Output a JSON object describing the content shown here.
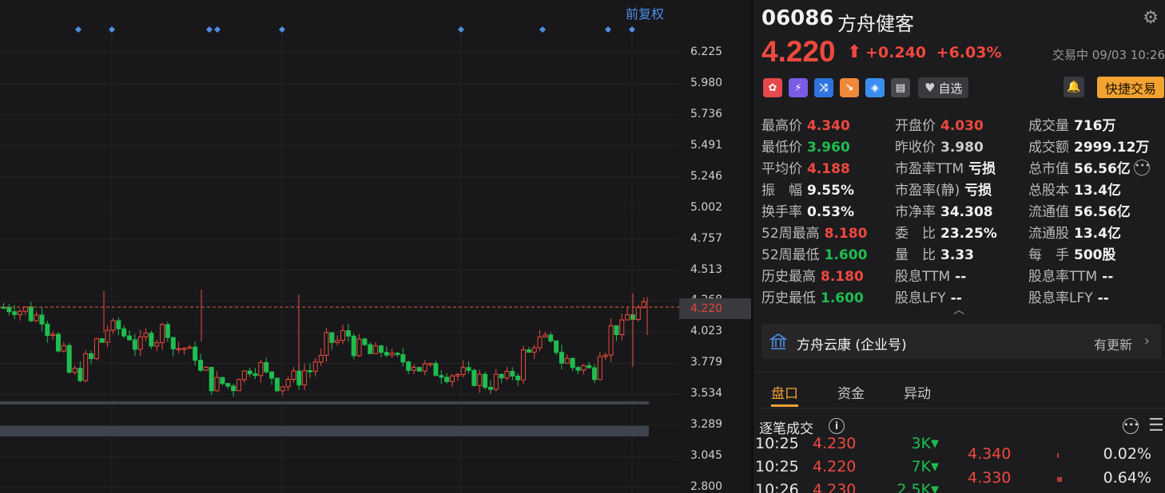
{
  "chart": {
    "adjust_label": "前复权",
    "y_ticks": [
      "6.225",
      "5.980",
      "5.736",
      "5.491",
      "5.246",
      "5.002",
      "4.757",
      "4.513",
      "4.268",
      "4.023",
      "3.779",
      "3.534",
      "3.289",
      "3.045",
      "2.800"
    ],
    "y_min": 2.8,
    "y_max": 6.225,
    "current_price_label": "4.220",
    "current_price": 4.22,
    "event_marker_x": [
      98,
      140,
      262,
      272,
      353,
      577,
      679,
      761,
      791
    ],
    "colors": {
      "up": "#ee4a3e",
      "down": "#1fbd4f",
      "marker": "#4f8fe8"
    }
  },
  "stock": {
    "code": "06086",
    "name": "方舟健客",
    "price": "4.220",
    "change": "+0.240",
    "change_pct": "+6.03%",
    "status": "交易中 09/03 10:26"
  },
  "toolbar": {
    "watch_label": "自选",
    "quick_trade_label": "快捷交易",
    "icons": [
      "hk-market-icon",
      "lightning-icon",
      "shuffle-icon",
      "trend-icon",
      "tag-icon",
      "note-icon"
    ]
  },
  "stats": [
    [
      {
        "label": "最高价",
        "value": "4.340",
        "color": "red"
      },
      {
        "label": "开盘价",
        "value": "4.030",
        "color": "red"
      },
      {
        "label": "成交量",
        "value": "716万",
        "color": "white"
      }
    ],
    [
      {
        "label": "最低价",
        "value": "3.960",
        "color": "green"
      },
      {
        "label": "昨收价",
        "value": "3.980",
        "color": "gray"
      },
      {
        "label": "成交额",
        "value": "2999.12万",
        "color": "white"
      }
    ],
    [
      {
        "label": "平均价",
        "value": "4.188",
        "color": "red"
      },
      {
        "label": "市盈率TTM",
        "value": "亏损",
        "color": "white"
      },
      {
        "label": "总市值",
        "value": "56.56亿",
        "color": "white"
      }
    ],
    [
      {
        "label": "振　幅",
        "value": "9.55%",
        "color": "white"
      },
      {
        "label": "市盈率(静)",
        "value": "亏损",
        "color": "white"
      },
      {
        "label": "总股本",
        "value": "13.4亿",
        "color": "white"
      }
    ],
    [
      {
        "label": "换手率",
        "value": "0.53%",
        "color": "white"
      },
      {
        "label": "市净率",
        "value": "34.308",
        "color": "white"
      },
      {
        "label": "流通值",
        "value": "56.56亿",
        "color": "white"
      }
    ],
    [
      {
        "label": "52周最高",
        "value": "8.180",
        "color": "red"
      },
      {
        "label": "委　比",
        "value": "23.25%",
        "color": "white"
      },
      {
        "label": "流通股",
        "value": "13.4亿",
        "color": "white"
      }
    ],
    [
      {
        "label": "52周最低",
        "value": "1.600",
        "color": "green"
      },
      {
        "label": "量　比",
        "value": "3.33",
        "color": "white"
      },
      {
        "label": "每　手",
        "value": "500股",
        "color": "white"
      }
    ],
    [
      {
        "label": "历史最高",
        "value": "8.180",
        "color": "red"
      },
      {
        "label": "股息TTM",
        "value": "--",
        "color": "white"
      },
      {
        "label": "股息率TTM",
        "value": "--",
        "color": "white"
      }
    ],
    [
      {
        "label": "历史最低",
        "value": "1.600",
        "color": "green"
      },
      {
        "label": "股息LFY",
        "value": "--",
        "color": "white"
      },
      {
        "label": "股息率LFY",
        "value": "--",
        "color": "white"
      }
    ]
  ],
  "company": {
    "name": "方舟云康 (企业号)",
    "update_label": "有更新"
  },
  "tabs": [
    "盘口",
    "资金",
    "异动"
  ],
  "ticks": {
    "title": "逐笔成交",
    "trades": [
      {
        "time": "10:25",
        "price": "4.230",
        "vol": "3K"
      },
      {
        "time": "10:25",
        "price": "4.220",
        "vol": "7K"
      },
      {
        "time": "10:26",
        "price": "4.230",
        "vol": "2.5K"
      }
    ],
    "distribution": [
      {
        "price": "4.340",
        "pct": "0.02%",
        "share": 0.02
      },
      {
        "price": "4.330",
        "pct": "0.64%",
        "share": 0.64
      }
    ]
  }
}
